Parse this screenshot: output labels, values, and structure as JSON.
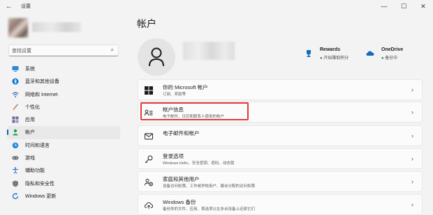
{
  "window": {
    "title": "设置",
    "back": "←",
    "min": "—",
    "max": "☐",
    "close": "✕"
  },
  "search": {
    "placeholder": "查找设置"
  },
  "nav": [
    {
      "label": "系统",
      "icon": "monitor-icon",
      "color": "#2b88d8"
    },
    {
      "label": "蓝牙和其他设备",
      "icon": "bluetooth-icon",
      "color": "#0078d4"
    },
    {
      "label": "网络和 Internet",
      "icon": "wifi-icon",
      "color": "#3b6fb6"
    },
    {
      "label": "个性化",
      "icon": "brush-icon",
      "color": "#e08a3b"
    },
    {
      "label": "应用",
      "icon": "apps-icon",
      "color": "#6a6a9a"
    },
    {
      "label": "帐户",
      "icon": "person-icon",
      "color": "#1aa05a",
      "active": true
    },
    {
      "label": "时间和语言",
      "icon": "globe-clock-icon",
      "color": "#2a8bd8"
    },
    {
      "label": "游戏",
      "icon": "gamepad-icon",
      "color": "#6a6a6a"
    },
    {
      "label": "辅助功能",
      "icon": "accessibility-icon",
      "color": "#2b6fc9"
    },
    {
      "label": "隐私和安全性",
      "icon": "shield-icon",
      "color": "#7a7a7a"
    },
    {
      "label": "Windows 更新",
      "icon": "update-icon",
      "color": "#1c6fd1"
    }
  ],
  "main": {
    "title": "帐户",
    "rewards": {
      "title": "Rewards",
      "sub": "开始赚取积分"
    },
    "onedrive": {
      "title": "OneDrive",
      "sub": "备份中"
    },
    "cards": [
      {
        "title": "你的 Microsoft 帐户",
        "sub": "订阅、奖励等",
        "icon": "windows-logo-icon"
      },
      {
        "title": "帐户信息",
        "sub": "电子邮件、日历和联系人使用的帐户",
        "icon": "account-info-icon",
        "highlighted": true
      },
      {
        "title": "电子邮件和帐户",
        "sub": "",
        "icon": "mail-icon"
      },
      {
        "title": "登录选项",
        "sub": "Windows Hello、安全密钥、密码、动态锁",
        "icon": "key-icon"
      },
      {
        "title": "家庭和其他用户",
        "sub": "设备访问权限、工作或学校用户、展台分配的访问权限",
        "icon": "family-icon"
      },
      {
        "title": "Windows 备份",
        "sub": "备份你的文件、应用、首选项以在多台设备上还原它们",
        "icon": "backup-icon"
      }
    ],
    "chevron": "›"
  },
  "colors": {
    "accent": "#0067c0",
    "highlight": "#e23a3a"
  }
}
